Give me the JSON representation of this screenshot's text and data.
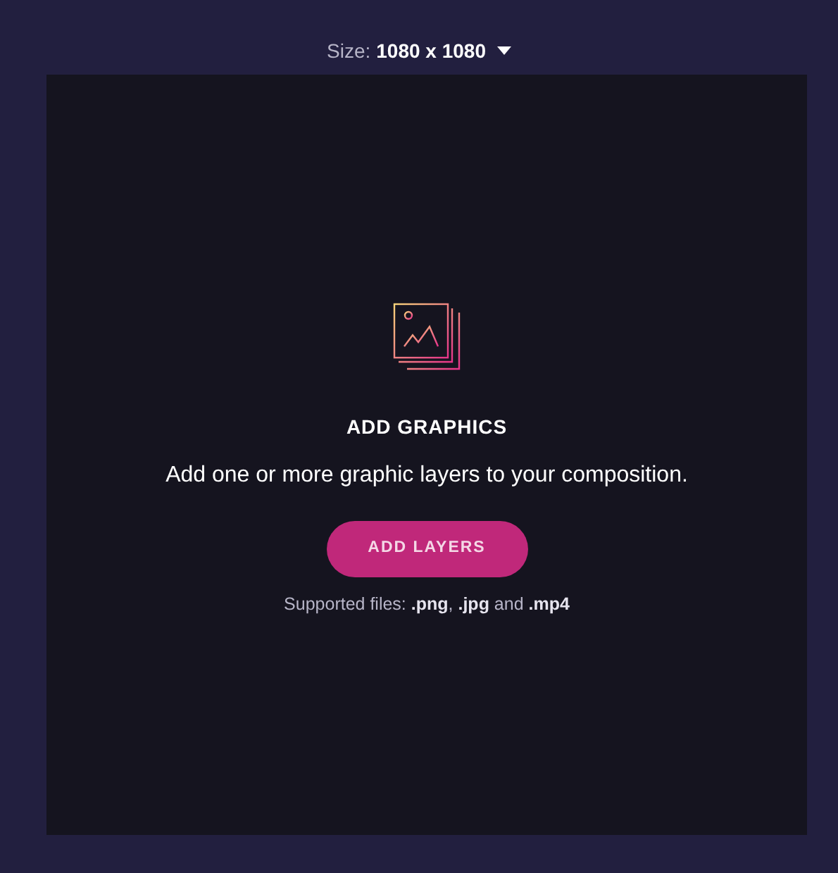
{
  "size_selector": {
    "label": "Size:",
    "value": "1080 x 1080"
  },
  "empty_state": {
    "title": "ADD GRAPHICS",
    "description": "Add one or more graphic layers to your composition.",
    "button": "ADD LAYERS",
    "note": "Supported files: **.png**, **.jpg** and **.mp4**"
  }
}
